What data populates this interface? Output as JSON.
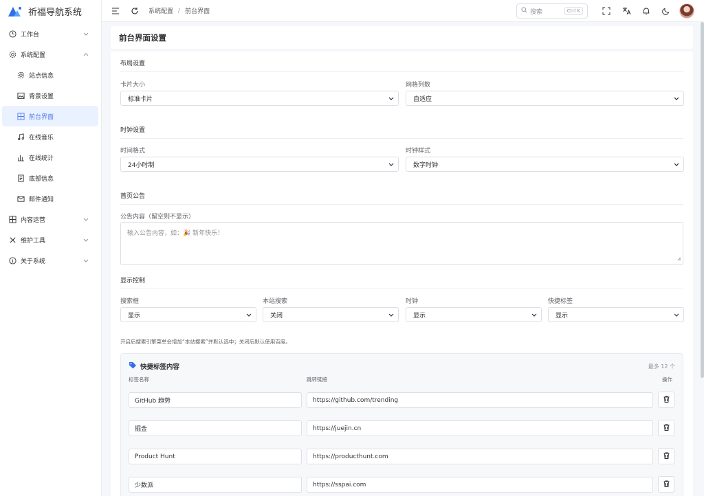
{
  "app": {
    "title": "祈福导航系统"
  },
  "sidebar": {
    "items": [
      {
        "label": "工作台"
      },
      {
        "label": "系统配置"
      },
      {
        "label": "站点信息"
      },
      {
        "label": "背景设置"
      },
      {
        "label": "前台界面"
      },
      {
        "label": "在线音乐"
      },
      {
        "label": "在线统计"
      },
      {
        "label": "底部信息"
      },
      {
        "label": "邮件通知"
      },
      {
        "label": "内容运营"
      },
      {
        "label": "维护工具"
      },
      {
        "label": "关于系统"
      }
    ]
  },
  "header": {
    "breadcrumb": [
      "系统配置",
      "/",
      "前台界面"
    ],
    "search_placeholder": "搜索",
    "search_kbd": "Ctrl K"
  },
  "page": {
    "title": "前台界面设置"
  },
  "layout_section": {
    "title": "布局设置",
    "card_size_label": "卡片大小",
    "card_size_value": "标准卡片",
    "grid_cols_label": "网格列数",
    "grid_cols_value": "自适应"
  },
  "clock_section": {
    "title": "时钟设置",
    "time_format_label": "时间格式",
    "time_format_value": "24小时制",
    "clock_style_label": "时钟样式",
    "clock_style_value": "数字时钟"
  },
  "notice_section": {
    "title": "首页公告",
    "content_label": "公告内容（留空则不显示）",
    "placeholder": "输入公告内容，如：🎉 新年快乐！"
  },
  "display_section": {
    "title": "显示控制",
    "search_label": "搜索框",
    "search_value": "显示",
    "site_search_label": "本站搜索",
    "site_search_value": "关闭",
    "clock_label": "时钟",
    "clock_value": "显示",
    "quick_tags_label": "快捷标签",
    "quick_tags_value": "显示",
    "hint": "开启后搜索引擎菜单会增加“本站搜索”并默认选中；关闭后默认使用百度。"
  },
  "quick_tags": {
    "title": "快捷标签内容",
    "max": "最多 12 个",
    "col_name": "标签名称",
    "col_link": "跳转链接",
    "col_action": "操作",
    "rows": [
      {
        "name": "GitHub 趋势",
        "url": "https://github.com/trending"
      },
      {
        "name": "掘金",
        "url": "https://juejin.cn"
      },
      {
        "name": "Product Hunt",
        "url": "https://producthunt.com"
      },
      {
        "name": "少数派",
        "url": "https://sspai.com"
      }
    ]
  },
  "colors": {
    "accent": "#4f7cf3",
    "active_bg": "#eaf1ff",
    "border": "#dcdfe6"
  }
}
